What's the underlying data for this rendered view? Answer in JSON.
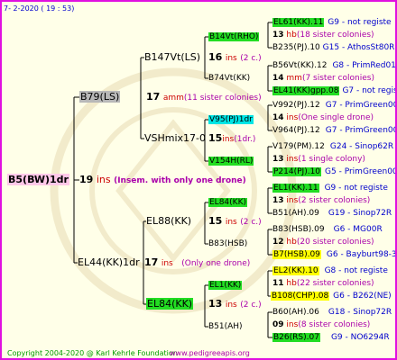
{
  "header": {
    "date": "7-  2-2020  ( 19 : 53)"
  },
  "root": {
    "name": "B5(BW)1dr",
    "num": "19",
    "ins": "ins",
    "note": "(Insem. with only one drone)"
  },
  "l1": {
    "name": "B79(LS)",
    "num": "17",
    "ins": "amm",
    "note": "(11 sister colonies)"
  },
  "l2": {
    "name": "EL44(KK)1dr",
    "num": "17",
    "ins": "ins",
    "note": "(Only one drone)"
  },
  "l1a": {
    "name": "B147Vt(LS)",
    "num": "16",
    "ins": "ins",
    "note": "(2 c.)"
  },
  "l1b": {
    "name": "VSHmix17-0",
    "num": "15",
    "ins": "ins",
    "note": "(1dr.)"
  },
  "l2a": {
    "name": "EL88(KK)",
    "num": "15",
    "ins": "ins",
    "note": "(2 c.)"
  },
  "l2b": {
    "name": "EL84(KK)",
    "num": "13",
    "ins": "ins",
    "note": "(2 c.)"
  },
  "p1": {
    "name": "B14Vt(RHO)",
    "num": "13",
    "ins": "hb",
    "note": "(18 sister colonies)",
    "top": "EL61(KK).11",
    "topinfo": "G9 - not registe",
    "bot": "B235(PJ).10",
    "botinfo": "G15 - AthosSt80R"
  },
  "p2": {
    "name": "B74Vt(KK)",
    "num": "14",
    "ins": "mm",
    "note": "(7 sister colonies)",
    "top": "B56Vt(KK).12",
    "topinfo": "G8 - PrimRed01",
    "bot": "EL41(KK)gpp.08",
    "botinfo": "G7 - not registe"
  },
  "p3": {
    "name": "V95(PJ)1dr",
    "num": "14",
    "ins": "ins",
    "note": "(One single drone)",
    "top": "V992(PJ).12",
    "topinfo": "G7 - PrimGreen00",
    "bot": "V964(PJ).12",
    "botinfo": "G7 - PrimGreen00"
  },
  "p4": {
    "name": "V154H(RL)",
    "num": "13",
    "ins": "ins",
    "note": "(1 single colony)",
    "top": "V179(PM).12",
    "topinfo": "G24 - Sinop62R",
    "bot": "P214(PJ).10",
    "botinfo": "G5 - PrimGreen00"
  },
  "p5": {
    "name": "EL84(KK)",
    "num": "13",
    "ins": "ins",
    "note": "(2 sister colonies)",
    "top": "EL1(KK).11",
    "topinfo": "G9 - not registe",
    "bot": "B51(AH).09",
    "botinfo": "G19 - Sinop72R"
  },
  "p6": {
    "name": "B83(HSB)",
    "num": "12",
    "ins": "hb",
    "note": "(20 sister colonies)",
    "top": "B83(HSB).09",
    "topinfo": "G6 - MG00R",
    "bot": "B7(HSB).09",
    "botinfo": "G6 - Bayburt98-3"
  },
  "p7": {
    "name": "EL1(KK)",
    "num": "11",
    "ins": "hb",
    "note": "(22 sister colonies)",
    "top": "EL2(KK).10",
    "topinfo": "G8 - not registe",
    "bot": "B108(CHP).08",
    "botinfo": "G6 - B262(NE)"
  },
  "p8": {
    "name": "B51(AH)",
    "num": "09",
    "ins": "ins",
    "note": "(8 sister colonies)",
    "top": "B60(AH).06",
    "topinfo": "G18 - Sinop72R",
    "bot": "B26(RS).07",
    "botinfo": "G9 - NO6294R"
  },
  "footer": {
    "copyright": "Copyright 2004-2020 @ Karl Kehrle Foundation",
    "url": "www.pedigreeapis.org"
  }
}
